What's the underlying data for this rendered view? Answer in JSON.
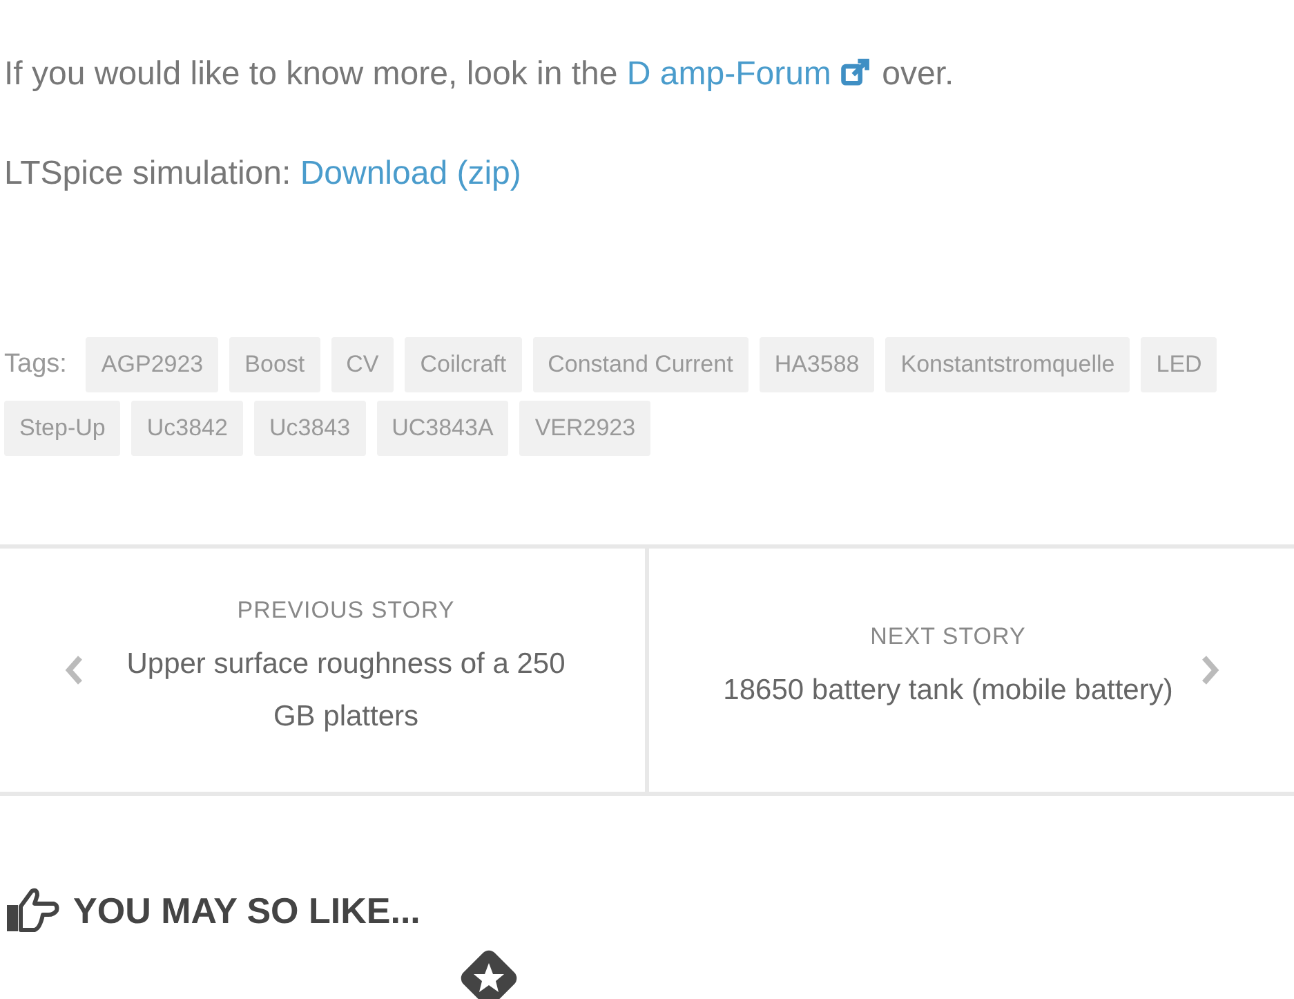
{
  "paragraphs": [
    {
      "before": "If you would like to know more, look in the ",
      "link": "D amp-Forum",
      "external": true,
      "after": " over."
    },
    {
      "before": "LTSpice simulation: ",
      "link": "Download (zip)",
      "external": false
    }
  ],
  "tags_label": "Tags:",
  "tags": [
    "AGP2923",
    "Boost",
    "CV",
    "Coilcraft",
    "Constand Current",
    "HA3588",
    "Konstantstromquelle",
    "LED",
    "Step-Up",
    "Uc3842",
    "Uc3843",
    "UC3843A",
    "VER2923"
  ],
  "story_nav": [
    {
      "kind": "previous",
      "label": "PREVIOUS STORY",
      "title": "Upper surface roughness of a 250 GB platters"
    },
    {
      "kind": "next",
      "label": "NEXT STORY",
      "title": "18650 battery tank (mobile battery)"
    }
  ],
  "related_heading": "YOU MAY SO LIKE..."
}
